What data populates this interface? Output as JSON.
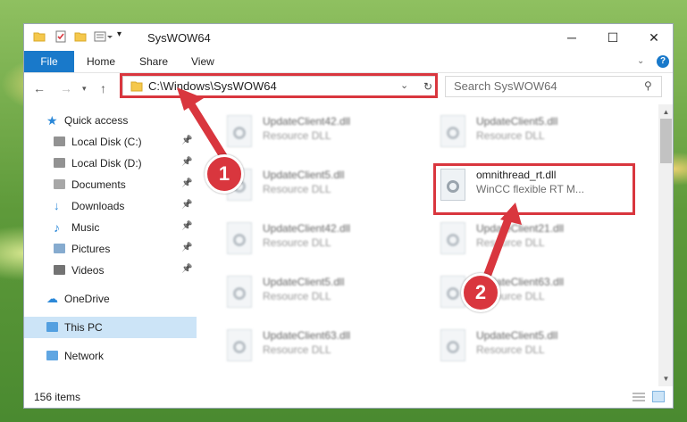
{
  "window": {
    "title": "SysWOW64",
    "minimize": "─",
    "maximize": "☐",
    "close": "✕"
  },
  "ribbon": {
    "tabs": [
      "File",
      "Home",
      "Share",
      "View"
    ],
    "expand_icon": "chevron-down-icon",
    "help_icon": "help-icon"
  },
  "address": {
    "path": "C:\\Windows\\SysWOW64",
    "search_placeholder": "Search SysWOW64"
  },
  "nav": {
    "items": [
      {
        "label": "Quick access",
        "icon": "star-icon",
        "pinned": false
      },
      {
        "label": "Local Disk (C:)",
        "icon": "drive-icon",
        "pinned": true
      },
      {
        "label": "Local Disk (D:)",
        "icon": "drive-icon",
        "pinned": true
      },
      {
        "label": "Documents",
        "icon": "documents-icon",
        "pinned": true
      },
      {
        "label": "Downloads",
        "icon": "downloads-icon",
        "pinned": true
      },
      {
        "label": "Music",
        "icon": "music-icon",
        "pinned": true
      },
      {
        "label": "Pictures",
        "icon": "pictures-icon",
        "pinned": true
      },
      {
        "label": "Videos",
        "icon": "videos-icon",
        "pinned": true
      },
      {
        "label": "OneDrive",
        "icon": "cloud-icon",
        "pinned": false
      },
      {
        "label": "This PC",
        "icon": "computer-icon",
        "pinned": false,
        "selected": true
      },
      {
        "label": "Network",
        "icon": "network-icon",
        "pinned": false
      }
    ]
  },
  "files": [
    {
      "name": "UpdateClient42.dll",
      "desc": "Resource DLL",
      "blurred": true
    },
    {
      "name": "UpdateClient5.dll",
      "desc": "Resource DLL",
      "blurred": true
    },
    {
      "name": "UpdateClient5.dll",
      "desc": "Resource DLL",
      "blurred": true
    },
    {
      "name": "omnithread_rt.dll",
      "desc": "WinCC flexible RT M...",
      "blurred": false
    },
    {
      "name": "UpdateClient42.dll",
      "desc": "Resource DLL",
      "blurred": true
    },
    {
      "name": "UpdateClient21.dll",
      "desc": "Resource DLL",
      "blurred": true
    },
    {
      "name": "UpdateClient5.dll",
      "desc": "Resource DLL",
      "blurred": true
    },
    {
      "name": "UpdateClient63.dll",
      "desc": "Resource DLL",
      "blurred": true
    },
    {
      "name": "UpdateClient63.dll",
      "desc": "Resource DLL",
      "blurred": true
    },
    {
      "name": "UpdateClient5.dll",
      "desc": "Resource DLL",
      "blurred": true
    }
  ],
  "status": {
    "item_count": "156 items"
  },
  "callouts": [
    "1",
    "2"
  ],
  "colors": {
    "accent": "#1979ca",
    "annotation_red": "#d9363e",
    "selected_bg": "#cce4f7"
  }
}
